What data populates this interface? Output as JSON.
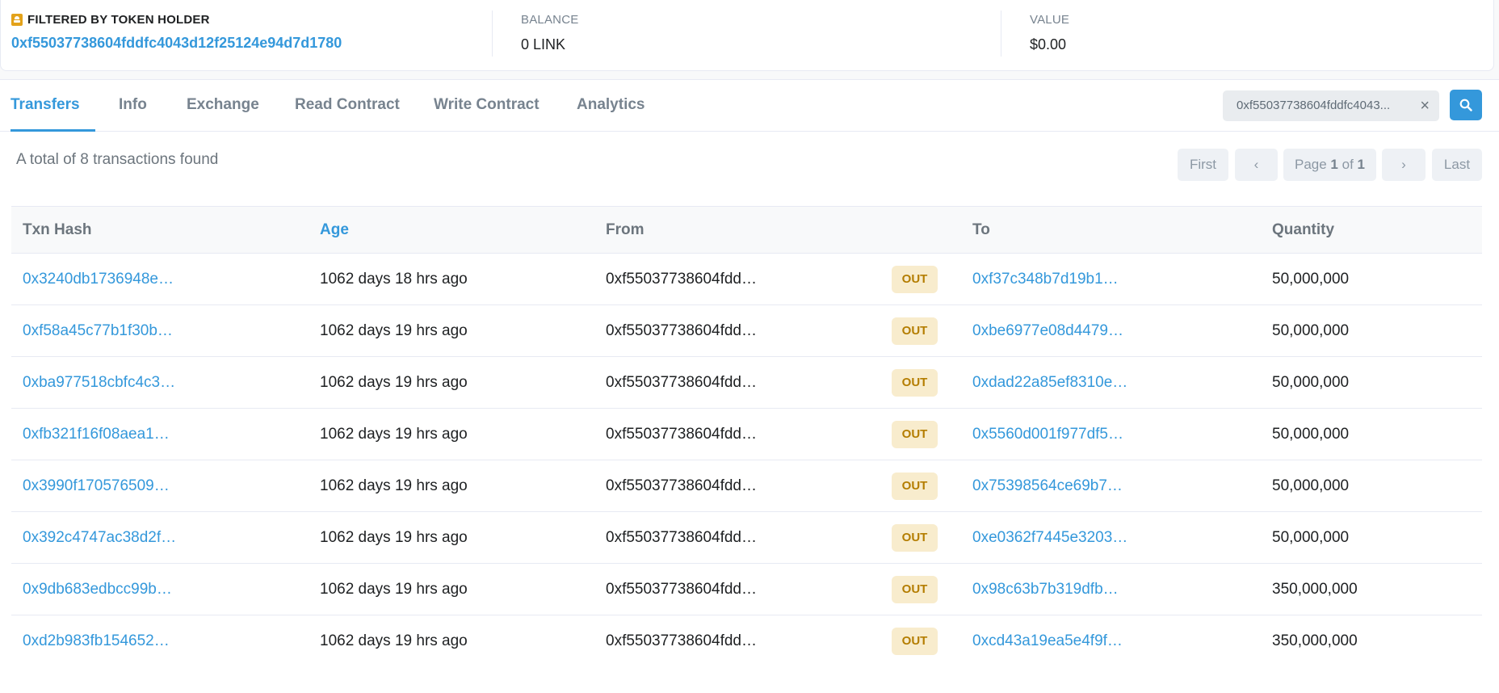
{
  "summary": {
    "holder_label": "FILTERED BY TOKEN HOLDER",
    "holder_address": "0xf55037738604fddfc4043d12f25124e94d7d1780",
    "balance_label": "BALANCE",
    "balance_value": "0 LINK",
    "value_label": "VALUE",
    "value_value": "$0.00"
  },
  "tabs": [
    "Transfers",
    "Info",
    "Exchange",
    "Read Contract",
    "Write Contract",
    "Analytics"
  ],
  "filter": {
    "value": "0xf55037738604fddfc4043..."
  },
  "total_text": "A total of 8 transactions found",
  "pager": {
    "first": "First",
    "prev": "<",
    "page_prefix": "Page",
    "page_current": "1",
    "page_of": "of",
    "page_total": "1",
    "next": ">",
    "last": "Last"
  },
  "table": {
    "headers": [
      "Txn Hash",
      "Age",
      "From",
      "",
      "To",
      "Quantity"
    ],
    "rows": [
      {
        "hash": "0x3240db1736948e…",
        "age": "1062 days 18 hrs ago",
        "from": "0xf55037738604fdd…",
        "dir": "OUT",
        "to": "0xf37c348b7d19b1…",
        "qty": "50,000,000"
      },
      {
        "hash": "0xf58a45c77b1f30b…",
        "age": "1062 days 19 hrs ago",
        "from": "0xf55037738604fdd…",
        "dir": "OUT",
        "to": "0xbe6977e08d4479…",
        "qty": "50,000,000"
      },
      {
        "hash": "0xba977518cbfc4c3…",
        "age": "1062 days 19 hrs ago",
        "from": "0xf55037738604fdd…",
        "dir": "OUT",
        "to": "0xdad22a85ef8310e…",
        "qty": "50,000,000"
      },
      {
        "hash": "0xfb321f16f08aea1…",
        "age": "1062 days 19 hrs ago",
        "from": "0xf55037738604fdd…",
        "dir": "OUT",
        "to": "0x5560d001f977df5…",
        "qty": "50,000,000"
      },
      {
        "hash": "0x3990f170576509…",
        "age": "1062 days 19 hrs ago",
        "from": "0xf55037738604fdd…",
        "dir": "OUT",
        "to": "0x75398564ce69b7…",
        "qty": "50,000,000"
      },
      {
        "hash": "0x392c4747ac38d2f…",
        "age": "1062 days 19 hrs ago",
        "from": "0xf55037738604fdd…",
        "dir": "OUT",
        "to": "0xe0362f7445e3203…",
        "qty": "50,000,000"
      },
      {
        "hash": "0x9db683edbcc99b…",
        "age": "1062 days 19 hrs ago",
        "from": "0xf55037738604fdd…",
        "dir": "OUT",
        "to": "0x98c63b7b319dfb…",
        "qty": "350,000,000"
      },
      {
        "hash": "0xd2b983fb154652…",
        "age": "1062 days 19 hrs ago",
        "from": "0xf55037738604fdd…",
        "dir": "OUT",
        "to": "0xcd43a19ea5e4f9f…",
        "qty": "350,000,000"
      }
    ]
  },
  "colors": {
    "link": "#3498db",
    "out_badge_bg": "#f8eccd",
    "out_badge_text": "#b47d00"
  },
  "icons": {
    "holder": "user-tag-icon",
    "clear": "close-icon",
    "search": "search-icon"
  }
}
